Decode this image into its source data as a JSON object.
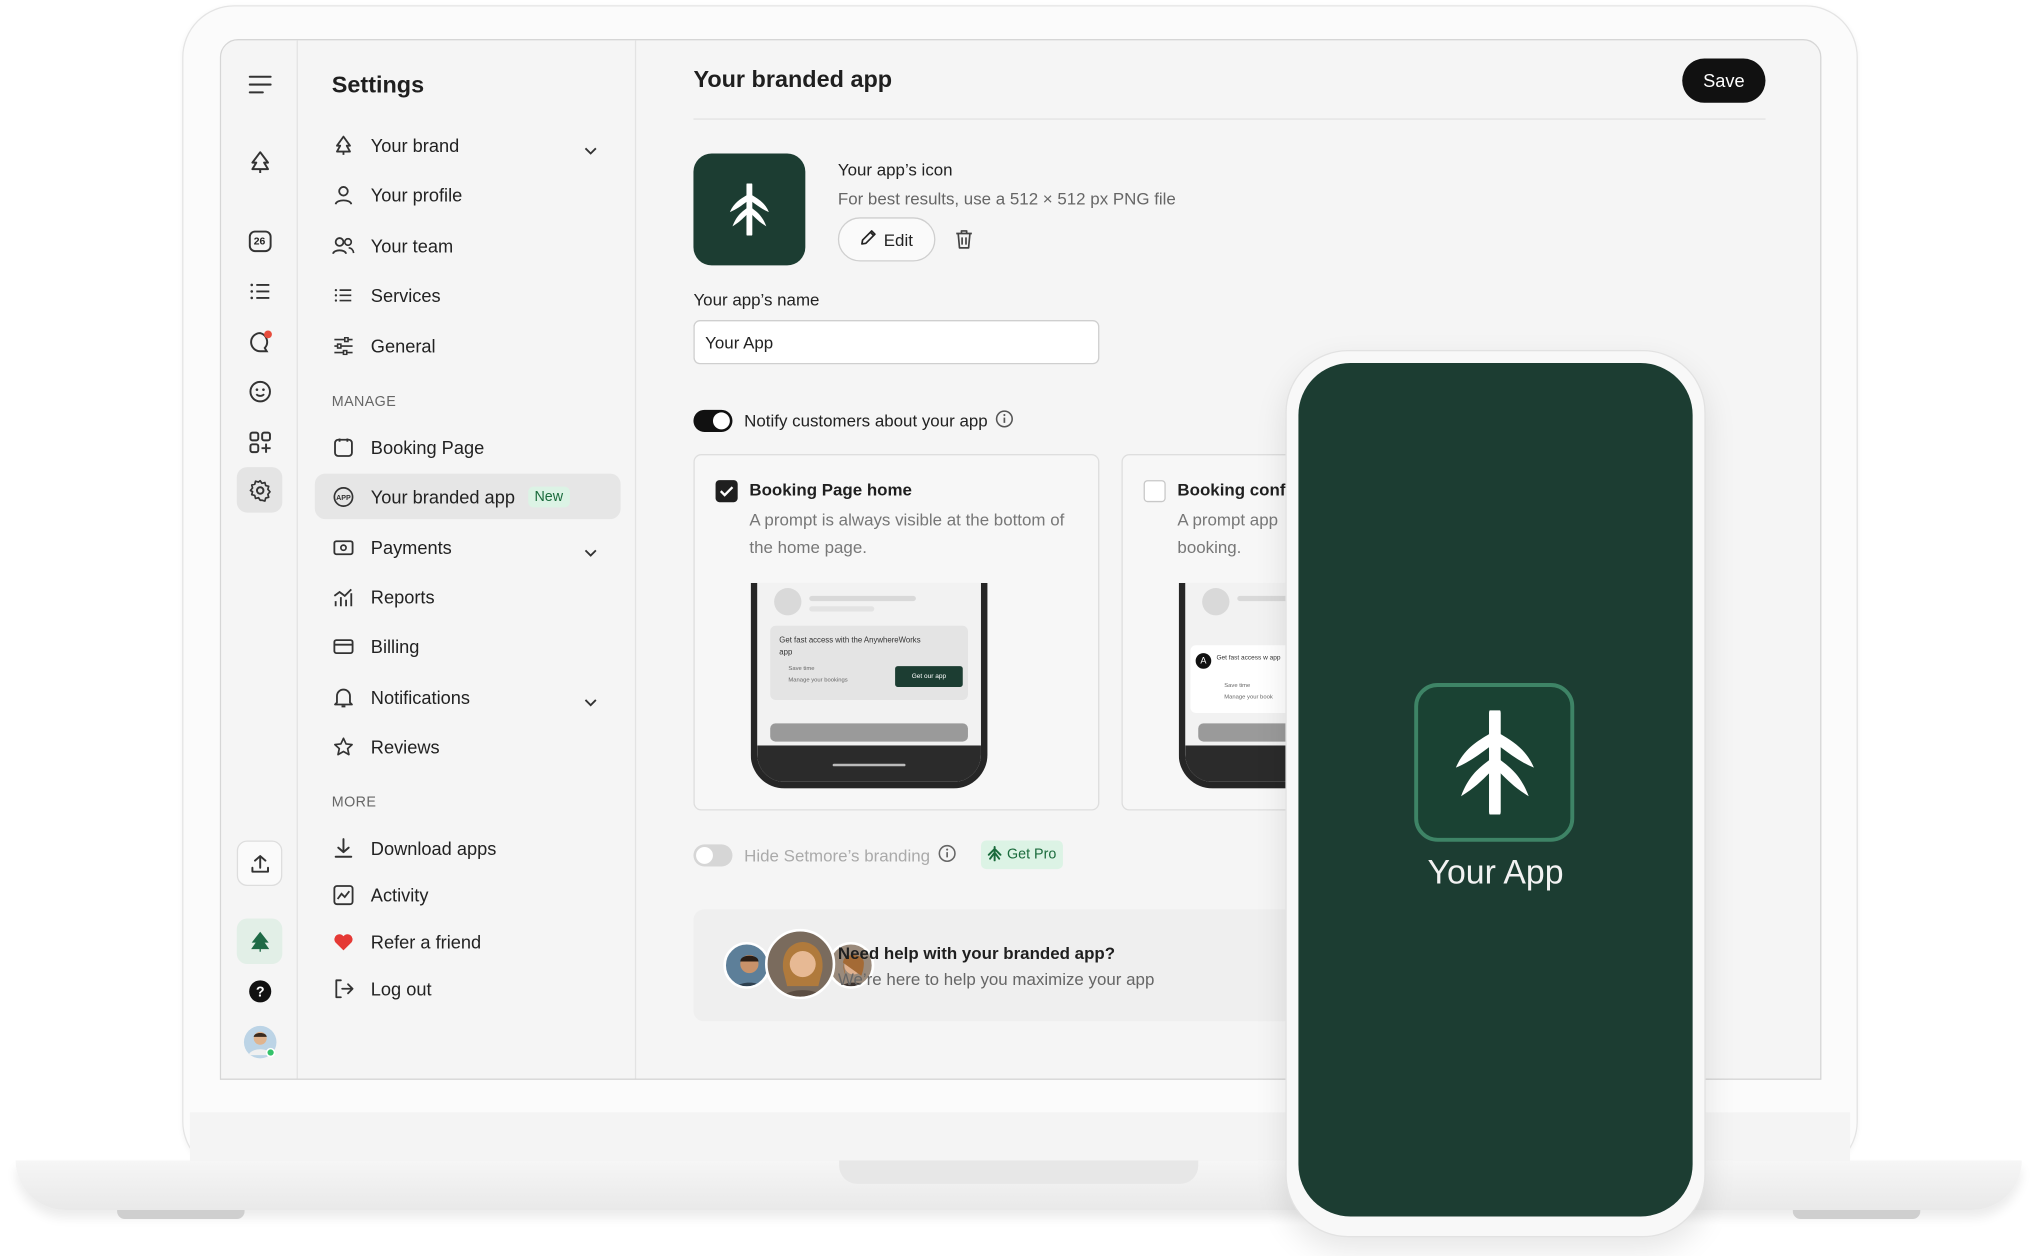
{
  "sidebar": {
    "title": "Settings",
    "items": [
      {
        "label": "Your brand"
      },
      {
        "label": "Your profile"
      },
      {
        "label": "Your team"
      },
      {
        "label": "Services"
      },
      {
        "label": "General"
      }
    ],
    "manage_label": "MANAGE",
    "manage_items": [
      {
        "label": "Booking Page"
      },
      {
        "label": "Your branded app",
        "badge": "New"
      },
      {
        "label": "Payments"
      },
      {
        "label": "Reports"
      },
      {
        "label": "Billing"
      },
      {
        "label": "Notifications"
      },
      {
        "label": "Reviews"
      }
    ],
    "more_label": "MORE",
    "more_items": [
      {
        "label": "Download apps"
      },
      {
        "label": "Activity"
      },
      {
        "label": "Refer a friend"
      },
      {
        "label": "Log out"
      }
    ]
  },
  "rail": {
    "calendar_date": "26"
  },
  "main": {
    "title": "Your branded app",
    "save_label": "Save",
    "icon_label": "Your app’s icon",
    "icon_hint": "For best results, use a 512 × 512 px PNG file",
    "edit_label": "Edit",
    "name_label": "Your app’s name",
    "name_value": "Your App",
    "notify_label": "Notify customers about your app",
    "notify_on": true,
    "cards": [
      {
        "title": "Booking Page home",
        "description": "A prompt is always visible at the bottom of the home page.",
        "checked": true,
        "preview_text": "Get fast access with the AnywhereWorks app",
        "preview_bullets": [
          "Save time",
          "Manage your bookings"
        ],
        "preview_button": "Get our app"
      },
      {
        "title": "Booking conf",
        "description": "A prompt app booking.",
        "checked": false,
        "preview_text": "Get fast access w app",
        "preview_bullets": [
          "Save time",
          "Manage your book"
        ]
      }
    ],
    "branding_label": "Hide Setmore’s branding",
    "branding_on": false,
    "get_pro_label": "Get Pro",
    "help_title": "Need help with your branded app?",
    "help_subtitle": "We’re here to help you maximize your app"
  },
  "phone": {
    "app_name": "Your App"
  },
  "colors": {
    "brand_green": "#1c3d32",
    "accent_green": "#3e8466",
    "badge_bg": "#dcf3e5"
  }
}
